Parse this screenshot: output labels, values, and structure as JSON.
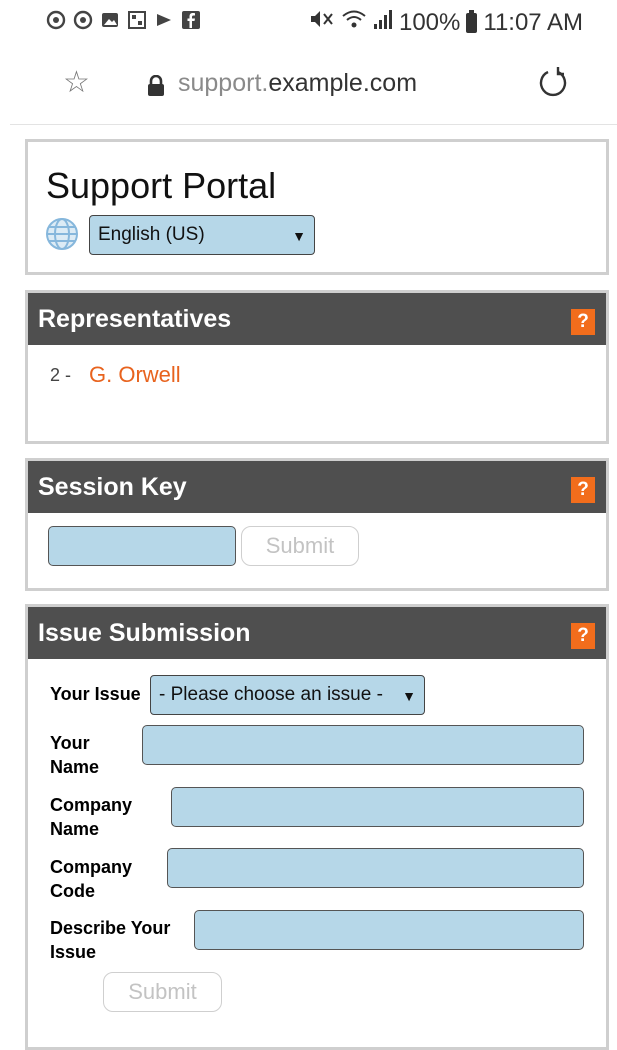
{
  "status_bar": {
    "battery": "100%",
    "time": "11:07 AM",
    "left_icons": [
      "sync-icon",
      "sync-icon",
      "image-icon",
      "qr-icon",
      "cast-icon",
      "facebook-icon"
    ],
    "right_icons": [
      "mute-icon",
      "wifi-icon",
      "signal-icon",
      "battery-icon"
    ]
  },
  "browser": {
    "url_subdomain": "support.",
    "url_domain": "example.com",
    "icons": [
      "star-icon",
      "lock-icon",
      "reload-icon"
    ]
  },
  "portal": {
    "title": "Support Portal",
    "language_selected": "English (US)",
    "icon": "globe-icon"
  },
  "representatives": {
    "title": "Representatives",
    "help": "?",
    "items": [
      {
        "number": "2 -",
        "name": "G. Orwell"
      }
    ]
  },
  "session_key": {
    "title": "Session Key",
    "help": "?",
    "submit_label": "Submit"
  },
  "issue_submission": {
    "title": "Issue Submission",
    "help": "?",
    "issue_label": "Your Issue",
    "issue_selected": "- Please choose an issue -",
    "name_label_1": "Your",
    "name_label_2": "Name",
    "company_label_1": "Company",
    "company_label_2": "Name",
    "code_label_1": "Company",
    "code_label_2": "Code",
    "describe_label_1": "Describe Your",
    "describe_label_2": "Issue",
    "submit_label": "Submit"
  },
  "colors": {
    "header_bg": "#4f4f4f",
    "help_bg": "#f26d1c",
    "field_bg": "#b6d7e8",
    "link": "#e8631e"
  }
}
